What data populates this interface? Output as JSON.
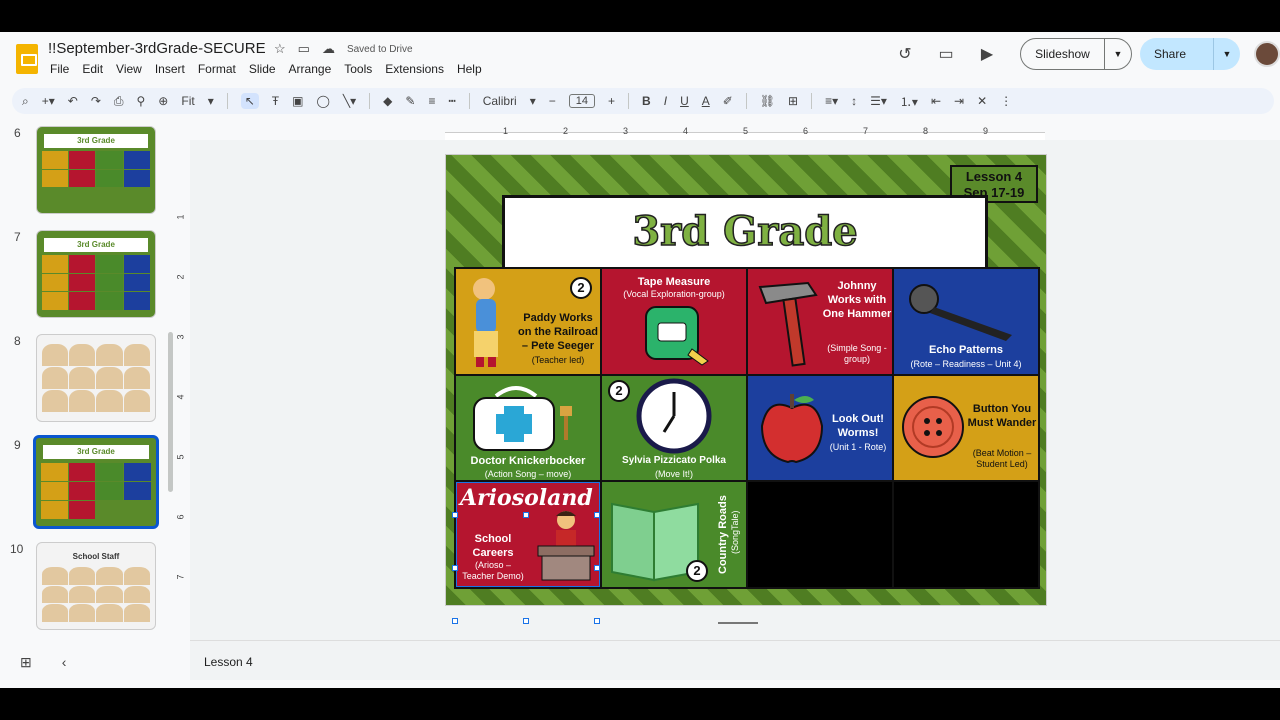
{
  "document": {
    "title": "!!September-3rdGrade-SECURE",
    "saved_status": "Saved to Drive"
  },
  "menu": [
    "File",
    "Edit",
    "View",
    "Insert",
    "Format",
    "Slide",
    "Arrange",
    "Tools",
    "Extensions",
    "Help"
  ],
  "header": {
    "slideshow_label": "Slideshow",
    "share_label": "Share"
  },
  "toolbar": {
    "zoom": "Fit",
    "font": "Calibri",
    "font_size": "14"
  },
  "ruler": {
    "h_numbers": [
      "1",
      "2",
      "3",
      "4",
      "5",
      "6",
      "7",
      "8",
      "9"
    ],
    "v_numbers": [
      "1",
      "2",
      "3",
      "4",
      "5",
      "6",
      "7"
    ]
  },
  "filmstrip": [
    {
      "number": "6",
      "label": "3rd Grade"
    },
    {
      "number": "7",
      "label": "3rd Grade"
    },
    {
      "number": "8",
      "label": ""
    },
    {
      "number": "9",
      "label": "3rd Grade",
      "active": true
    },
    {
      "number": "10",
      "label": "School Staff"
    }
  ],
  "slide": {
    "lesson_line1": "Lesson 4",
    "lesson_line2": "Sep 17-19",
    "grade_title": "3rd Grade",
    "tiles": {
      "paddy": {
        "badge": "2",
        "title": "Paddy Works on the Railroad – Pete Seeger",
        "sub": "(Teacher led)"
      },
      "tape": {
        "title": "Tape Measure",
        "sub": "(Vocal Exploration-group)"
      },
      "johnny": {
        "title": "Johnny Works with One Hammer",
        "sub": "(Simple Song - group)"
      },
      "echo": {
        "title": "Echo Patterns",
        "sub": "(Rote – Readiness – Unit 4)"
      },
      "doctor": {
        "title": "Doctor Knickerbocker",
        "sub": "(Action Song – move)"
      },
      "sylvia": {
        "badge": "2",
        "title": "Sylvia Pizzicato Polka",
        "sub": "(Move It!)"
      },
      "lookout": {
        "title": "Look Out! Worms!",
        "sub": "(Unit 1 - Rote)"
      },
      "button": {
        "title": "Button You Must Wander",
        "sub": "(Beat Motion – Student Led)"
      },
      "ariosoland": {
        "logo": "Ariosoland",
        "title": "School Careers",
        "sub": "(Arioso – Teacher Demo)"
      },
      "country": {
        "badge": "2",
        "title": "Country Roads",
        "sub": "(SongTale)"
      }
    }
  },
  "notes": {
    "text": "Lesson 4"
  }
}
